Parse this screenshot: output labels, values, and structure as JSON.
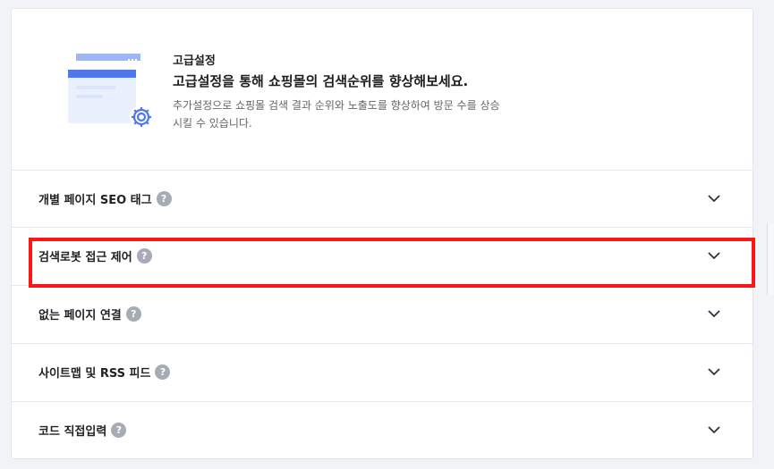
{
  "header": {
    "title": "고급설정",
    "subtitle": "고급설정을 통해 쇼핑몰의 검색순위를 향상해보세요.",
    "description": "추가설정으로 쇼핑몰 검색 결과 순위와 노출도를 향상하여 방문 수를 상승시킬 수 있습니다."
  },
  "sections": [
    {
      "label": "개별 페이지 SEO 태그",
      "help": "?",
      "icon": "chevron-down-icon"
    },
    {
      "label": "검색로봇 접근 제어",
      "help": "?",
      "icon": "chevron-down-icon"
    },
    {
      "label": "없는 페이지 연결",
      "help": "?",
      "icon": "chevron-down-icon"
    },
    {
      "label": "사이트맵 및 RSS 피드",
      "help": "?",
      "icon": "chevron-down-icon"
    },
    {
      "label": "코드 직접입력",
      "help": "?",
      "icon": "chevron-down-icon"
    }
  ],
  "colors": {
    "highlight": "#ff1515",
    "accent": "#4a72e8",
    "help_badge": "#a6abb5"
  }
}
